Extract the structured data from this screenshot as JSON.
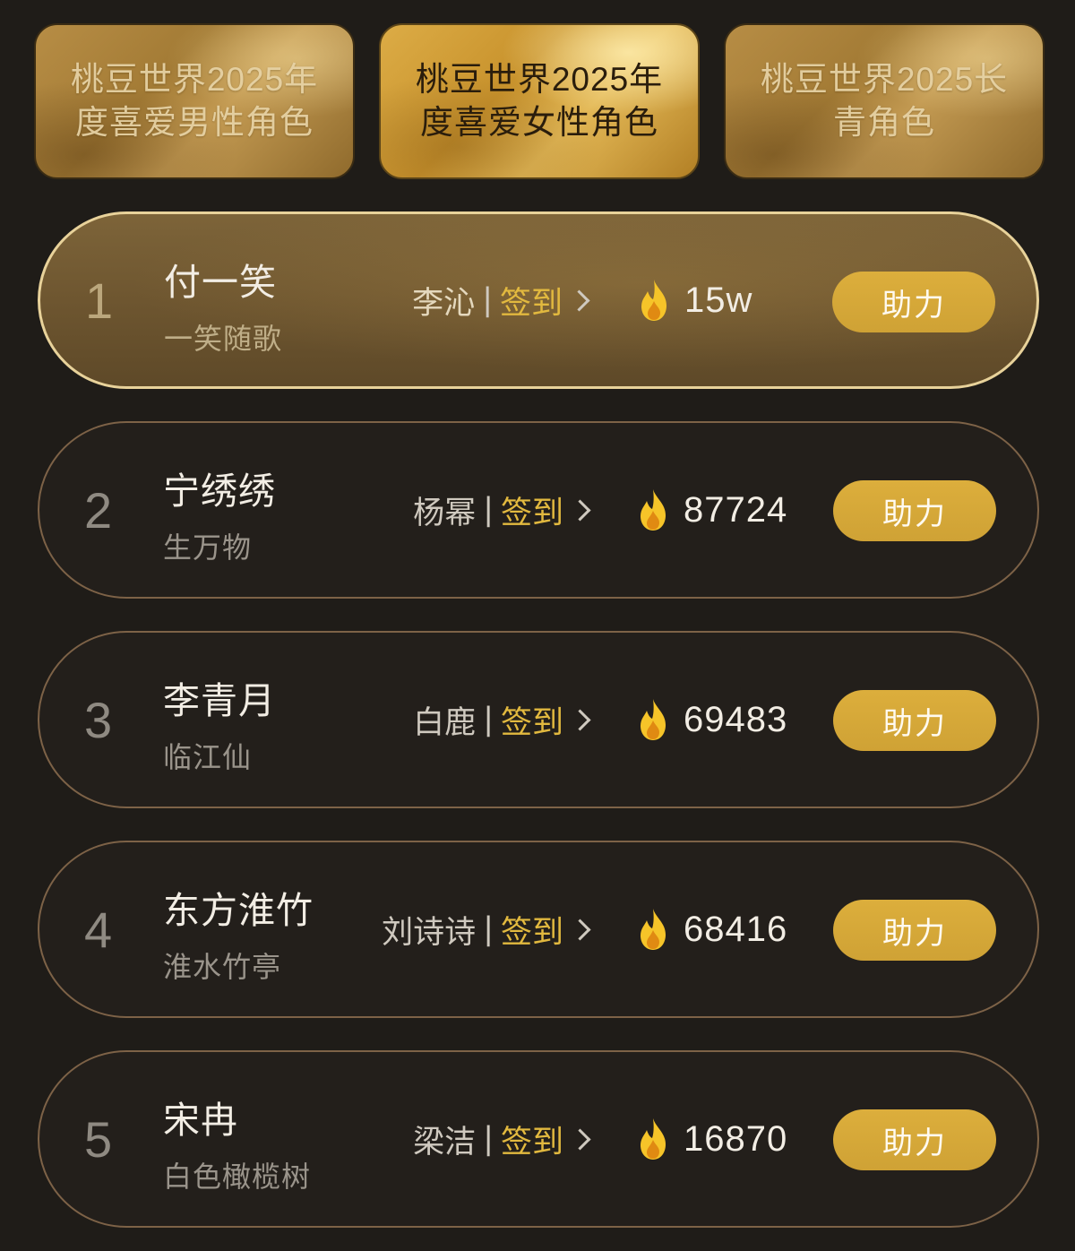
{
  "tabs": [
    {
      "label": "桃豆世界2025年度喜爱男性角色",
      "active": false
    },
    {
      "label": "桃豆世界2025年度喜爱女性角色",
      "active": true
    },
    {
      "label": "桃豆世界2025长青角色",
      "active": false
    }
  ],
  "rows": [
    {
      "rank": "1",
      "name": "付一笑",
      "subtitle": "一笑随歌",
      "actor": "李沁",
      "separator": "|",
      "signin": "签到",
      "heat": "15w",
      "boost": "助力"
    },
    {
      "rank": "2",
      "name": "宁绣绣",
      "subtitle": "生万物",
      "actor": "杨幂",
      "separator": "|",
      "signin": "签到",
      "heat": "87724",
      "boost": "助力"
    },
    {
      "rank": "3",
      "name": "李青月",
      "subtitle": "临江仙",
      "actor": "白鹿",
      "separator": "|",
      "signin": "签到",
      "heat": "69483",
      "boost": "助力"
    },
    {
      "rank": "4",
      "name": "东方淮竹",
      "subtitle": "淮水竹亭",
      "actor": "刘诗诗",
      "separator": "|",
      "signin": "签到",
      "heat": "68416",
      "boost": "助力"
    },
    {
      "rank": "5",
      "name": "宋冉",
      "subtitle": "白色橄榄树",
      "actor": "梁洁",
      "separator": "|",
      "signin": "签到",
      "heat": "16870",
      "boost": "助力"
    }
  ],
  "colors": {
    "background": "#1f1c18",
    "accent_gold": "#dcae3c",
    "signin_gold": "#e2b93f",
    "row_border": "#7d6247",
    "first_row_border": "#e8d29a"
  },
  "icons": {
    "heat": "flame-icon",
    "signin_arrow": "chevron-right-icon"
  }
}
